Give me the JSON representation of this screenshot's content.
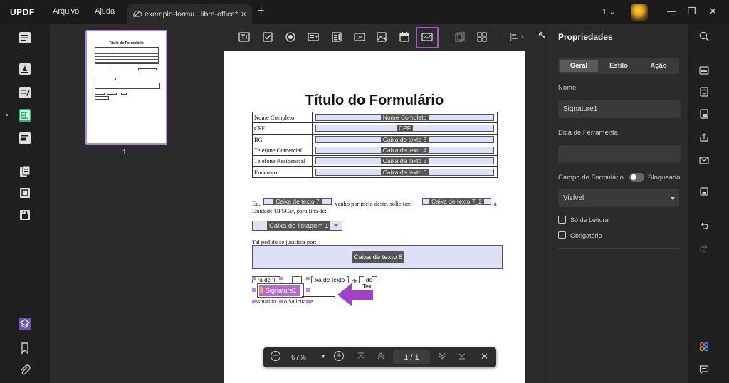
{
  "app": {
    "logo": "UPDF",
    "menu": [
      "Arquivo",
      "Ajuda"
    ]
  },
  "tab": {
    "title": "exemplo-formu...libre-office*",
    "close": "×",
    "new": "+"
  },
  "window": {
    "page_indicator": "1",
    "minimize": "—",
    "restore": "❐",
    "close": "✕"
  },
  "thumbnails": {
    "page_number": "1"
  },
  "document": {
    "title": "Título do Formulário",
    "rows": [
      {
        "label": "Nome Completo",
        "field": "Nome Completo"
      },
      {
        "label": "CPF",
        "field": "CPF"
      },
      {
        "label": "RG",
        "field": "Caixa de texto 3"
      },
      {
        "label": "Telefone Comercial",
        "field": "Caixa de texto 4"
      },
      {
        "label": "Telefone Residencial",
        "field": "Caixa de texto 5"
      },
      {
        "label": "Endereço",
        "field": "Caixa de texto 6"
      }
    ],
    "para_eu": "Eu,",
    "field7": "Caixa de texto 7",
    "para_mid": ", venho por meio deste, solicitar:",
    "field_7_2": "Caixa de texto 7_2",
    "para_a": "à",
    "para_line2": "Unidade UFSCar, para fins de:",
    "listbox": "Caixa de listagem 1",
    "justifica": "Tal pedido se justifica por:",
    "field8": "Caixa de texto 8",
    "date_left": "ra de fi",
    "date_mid": "xa de texto",
    "date_right": "de Tex",
    "date_de": "de",
    "signature": "Signature1",
    "assinatura_left": "ssinatura",
    "assinatura_mid": "o Solicita",
    "assinatura_e": "e"
  },
  "zoom": {
    "value": "67%",
    "page_current": "1",
    "page_sep": "/",
    "page_total": "1"
  },
  "properties": {
    "title": "Propriedades",
    "tabs": [
      "Geral",
      "Estilo",
      "Ação"
    ],
    "name_label": "Nome",
    "name_value": "Signature1",
    "tooltip_label": "Dica de Ferramenta",
    "tooltip_value": "",
    "form_field_label": "Campo do Formulário",
    "locked_label": "Bloqueado",
    "visibility": "Visível",
    "readonly_label": "Só de Leitura",
    "required_label": "Obrigatório"
  },
  "colors": {
    "accent": "#a45ab8",
    "field_bg": "#dde1f7",
    "signature": "#b56ad2",
    "arrow": "#a042c4"
  }
}
